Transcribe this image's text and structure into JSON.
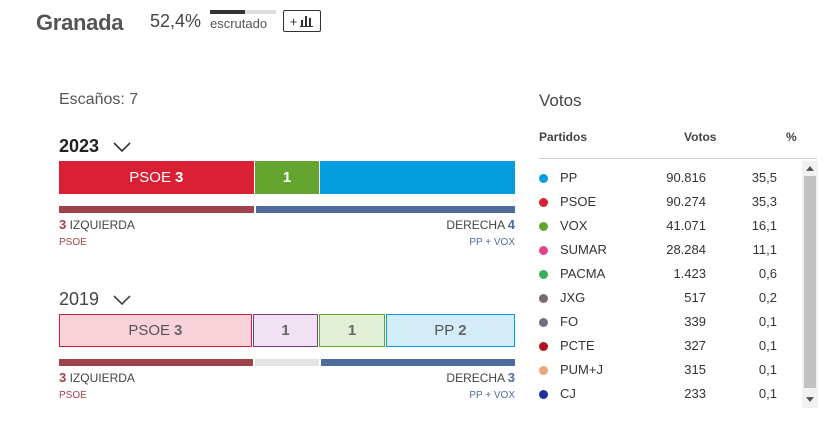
{
  "header": {
    "title": "Granada",
    "scrutiny_percent": "52,4%",
    "scrutiny_fraction": 0.524,
    "scrutiny_label": "escrutado",
    "more_button_label": "+",
    "more_button_icon": "bar-chart-icon"
  },
  "seats": {
    "title": "Escaños: 7",
    "y2023": {
      "year": "2023",
      "segments": [
        {
          "party": "PSOE",
          "seats": "3",
          "color": "#d91f34",
          "bg": "#d91f34",
          "share": 3
        },
        {
          "party": "",
          "seats": "1",
          "color": "#63a52e",
          "bg": "#63a52e",
          "share": 1
        },
        {
          "party": "",
          "seats": "",
          "color": "#049de0",
          "bg": "#049de0",
          "share": 3
        }
      ],
      "left_block": {
        "count": "3",
        "label": "IZQUIERDA",
        "parties": "PSOE",
        "color": "#a0424c",
        "seats": 3
      },
      "right_block": {
        "count": "4",
        "label": "DERECHA",
        "parties": "PP + VOX",
        "color": "#4e6c9b",
        "seats": 4
      },
      "undecided_seats": 0
    },
    "y2019": {
      "year": "2019",
      "segments": [
        {
          "party": "PSOE",
          "seats": "3",
          "color": "#d91f34",
          "bg": "#f8d2d8",
          "share": 3
        },
        {
          "party": "",
          "seats": "1",
          "color": "#7b3b8c",
          "bg": "#f1e2f3",
          "share": 1
        },
        {
          "party": "",
          "seats": "1",
          "color": "#63a52e",
          "bg": "#e1efd7",
          "share": 1
        },
        {
          "party": "PP",
          "seats": "2",
          "color": "#049de0",
          "bg": "#d2ecf8",
          "share": 2
        }
      ],
      "left_block": {
        "count": "3",
        "label": "IZQUIERDA",
        "parties": "PSOE",
        "color": "#a0424c",
        "seats": 3
      },
      "right_block": {
        "count": "3",
        "label": "DERECHA",
        "parties": "PP + VOX",
        "color": "#4e6c9b",
        "seats": 3
      },
      "undecided_seats": 1
    }
  },
  "votes": {
    "title": "Votos",
    "headers": {
      "party": "Partidos",
      "votes": "Votos",
      "percent": "%"
    },
    "rows": [
      {
        "party": "PP",
        "votes": "90.816",
        "percent": "35,5",
        "color": "#049de0"
      },
      {
        "party": "PSOE",
        "votes": "90.274",
        "percent": "35,3",
        "color": "#d91f34"
      },
      {
        "party": "VOX",
        "votes": "41.071",
        "percent": "16,1",
        "color": "#63a52e"
      },
      {
        "party": "SUMAR",
        "votes": "28.284",
        "percent": "11,1",
        "color": "#e5438d"
      },
      {
        "party": "PACMA",
        "votes": "1.423",
        "percent": "0,6",
        "color": "#35b05a"
      },
      {
        "party": "JXG",
        "votes": "517",
        "percent": "0,2",
        "color": "#7a6a74"
      },
      {
        "party": "FO",
        "votes": "339",
        "percent": "0,1",
        "color": "#6f6f80"
      },
      {
        "party": "PCTE",
        "votes": "327",
        "percent": "0,1",
        "color": "#b3101d"
      },
      {
        "party": "PUM+J",
        "votes": "315",
        "percent": "0,1",
        "color": "#eba77c"
      },
      {
        "party": "CJ",
        "votes": "233",
        "percent": "0,1",
        "color": "#1d2fa3"
      }
    ]
  }
}
